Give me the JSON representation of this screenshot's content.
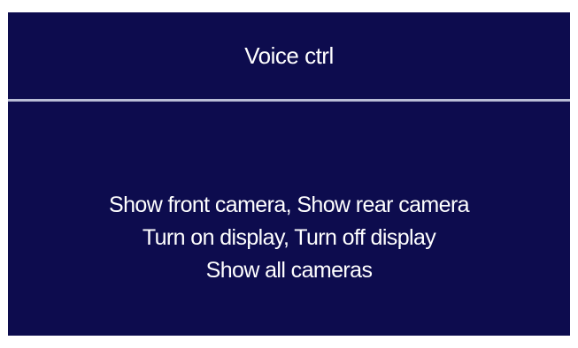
{
  "header": {
    "title": "Voice ctrl"
  },
  "commands": {
    "lines": [
      "Show front camera, Show rear camera",
      "Turn on display, Turn off display",
      "Show all cameras"
    ]
  },
  "colors": {
    "background": "#0d0c4e",
    "divider": "#b9bdd6",
    "text": "#ffffff"
  }
}
